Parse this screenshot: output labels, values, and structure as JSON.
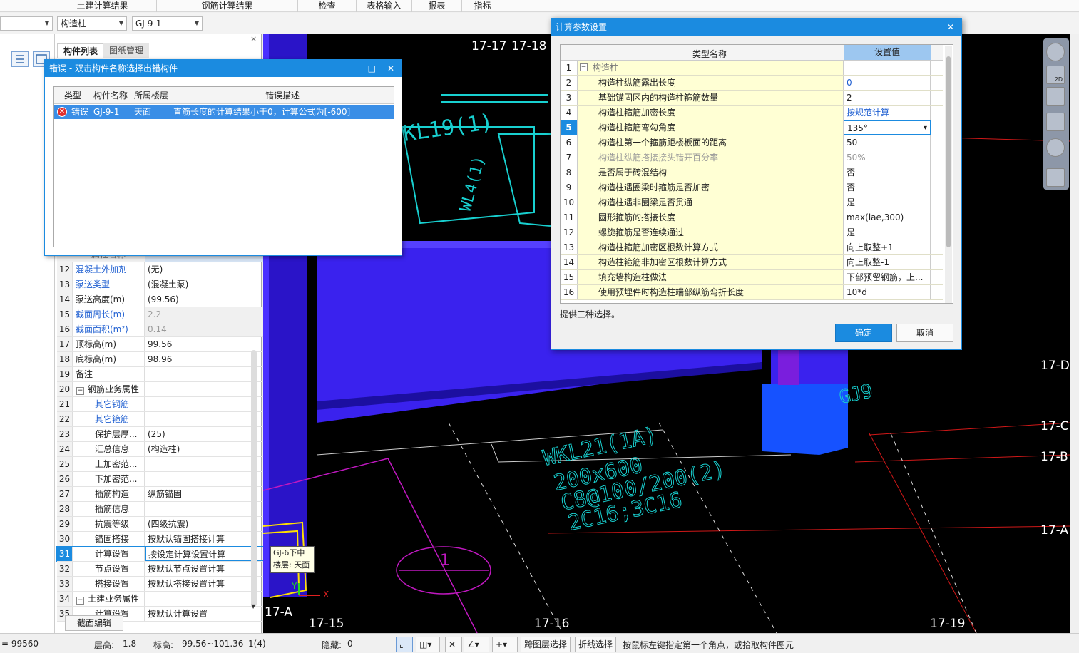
{
  "top_tabs": [
    "土建计算结果",
    "钢筋计算结果",
    "检查",
    "表格输入",
    "报表",
    "指标"
  ],
  "filter": {
    "combo1": "",
    "combo2": "构造柱",
    "combo3": "GJ-9-1"
  },
  "panel": {
    "tabs": [
      "构件列表",
      "图纸管理"
    ],
    "header_partial": "属性名称",
    "rows": [
      {
        "n": "12",
        "k": "混凝土外加剂",
        "v": "(无)",
        "kblue": true
      },
      {
        "n": "13",
        "k": "泵送类型",
        "v": "(混凝土泵)",
        "kblue": true
      },
      {
        "n": "14",
        "k": "泵送高度(m)",
        "v": "(99.56)"
      },
      {
        "n": "15",
        "k": "截面周长(m)",
        "v": "2.2",
        "kblue": true,
        "vgray": true
      },
      {
        "n": "16",
        "k": "截面面积(m²)",
        "v": "0.14",
        "kblue": true,
        "vgray": true
      },
      {
        "n": "17",
        "k": "顶标高(m)",
        "v": "99.56"
      },
      {
        "n": "18",
        "k": "底标高(m)",
        "v": "98.96"
      },
      {
        "n": "19",
        "k": "备注",
        "v": ""
      },
      {
        "n": "20",
        "k": "钢筋业务属性",
        "v": "",
        "group": true
      },
      {
        "n": "21",
        "k": "其它钢筋",
        "v": "",
        "kblue": true,
        "indent": true
      },
      {
        "n": "22",
        "k": "其它箍筋",
        "v": "",
        "kblue": true,
        "indent": true
      },
      {
        "n": "23",
        "k": "保护层厚...",
        "v": "(25)",
        "indent": true
      },
      {
        "n": "24",
        "k": "汇总信息",
        "v": "(构造柱)",
        "indent": true
      },
      {
        "n": "25",
        "k": "上加密范...",
        "v": "",
        "indent": true
      },
      {
        "n": "26",
        "k": "下加密范...",
        "v": "",
        "indent": true
      },
      {
        "n": "27",
        "k": "插筋构造",
        "v": "纵筋锚固",
        "indent": true
      },
      {
        "n": "28",
        "k": "插筋信息",
        "v": "",
        "indent": true
      },
      {
        "n": "29",
        "k": "抗震等级",
        "v": "(四级抗震)",
        "indent": true
      },
      {
        "n": "30",
        "k": "锚固搭接",
        "v": "按默认锚固搭接计算",
        "indent": true
      },
      {
        "n": "31",
        "k": "计算设置",
        "v": "按设定计算设置计算",
        "indent": true,
        "selected": true
      },
      {
        "n": "32",
        "k": "节点设置",
        "v": "按默认节点设置计算",
        "indent": true
      },
      {
        "n": "33",
        "k": "搭接设置",
        "v": "按默认搭接设置计算",
        "indent": true
      },
      {
        "n": "34",
        "k": "土建业务属性",
        "v": "",
        "group": true
      },
      {
        "n": "35",
        "k": "计算设置",
        "v": "按默认计算设置",
        "indent": true
      }
    ],
    "footer_button": "截面编辑"
  },
  "error_dialog": {
    "title": "错误 - 双击构件名称选择出错构件",
    "headers": [
      "类型",
      "构件名称",
      "所属楼层",
      "错误描述"
    ],
    "row": {
      "type": "错误",
      "name": "GJ-9-1",
      "floor": "天面",
      "desc": "直筋长度的计算结果小于0，计算公式为[-600]"
    }
  },
  "calc_dialog": {
    "title": "计算参数设置",
    "headers": [
      "类型名称",
      "设置值"
    ],
    "group_row": {
      "n": "1",
      "k": "构造柱"
    },
    "rows": [
      {
        "n": "2",
        "k": "构造柱纵筋露出长度",
        "v": "0",
        "vblue": true
      },
      {
        "n": "3",
        "k": "基础锚固区内的构造柱箍筋数量",
        "v": "2"
      },
      {
        "n": "4",
        "k": "构造柱箍筋加密长度",
        "v": "按规范计算",
        "vblue": true
      },
      {
        "n": "5",
        "k": "构造柱箍筋弯勾角度",
        "v": "135°",
        "selected": true
      },
      {
        "n": "6",
        "k": "构造柱第一个箍筋距楼板面的距离",
        "v": "50"
      },
      {
        "n": "7",
        "k": "构造柱纵筋搭接接头错开百分率",
        "v": "50%",
        "gray": true
      },
      {
        "n": "8",
        "k": "是否属于砖混结构",
        "v": "否"
      },
      {
        "n": "9",
        "k": "构造柱遇圈梁时箍筋是否加密",
        "v": "否"
      },
      {
        "n": "10",
        "k": "构造柱遇非圈梁是否贯通",
        "v": "是"
      },
      {
        "n": "11",
        "k": "圆形箍筋的搭接长度",
        "v": "max(lae,300)"
      },
      {
        "n": "12",
        "k": "螺旋箍筋是否连续通过",
        "v": "是"
      },
      {
        "n": "13",
        "k": "构造柱箍筋加密区根数计算方式",
        "v": "向上取整+1"
      },
      {
        "n": "14",
        "k": "构造柱箍筋非加密区根数计算方式",
        "v": "向上取整-1"
      },
      {
        "n": "15",
        "k": "填充墙构造柱做法",
        "v": "下部预留钢筋，上..."
      },
      {
        "n": "16",
        "k": "使用预埋件时构造柱端部纵筋弯折长度",
        "v": "10*d"
      }
    ],
    "hint": "提供三种选择。",
    "ok": "确定",
    "cancel": "取消"
  },
  "viewport": {
    "axis_labels": [
      "17-17",
      "17-18",
      "17-D",
      "17-C",
      "17-B",
      "17-A",
      "17-A",
      "17-15",
      "17-16",
      "17-19"
    ],
    "beam_label_top": "KL19(1)",
    "beam_label_left": "WL4(1)",
    "beam_text": [
      "WKL21(1A)",
      "200x600",
      "C8@100/200(2)",
      "2C16;3C16"
    ],
    "column_tag": "GJ9",
    "circle_label": "1",
    "tooltip": [
      "GJ-6下中",
      "楼层: 天面"
    ],
    "axis_x": "X",
    "axis_y": "Y"
  },
  "status": {
    "coord": "= 99560",
    "floor_height_label": "层高:",
    "floor_height": "1.8",
    "elev_label": "标高:",
    "elev": "99.56~101.36",
    "count": "1(4)",
    "hidden_label": "隐藏:",
    "hidden": "0",
    "cross_floor": "跨图层选择",
    "polyline": "折线选择",
    "prompt": "按鼠标左键指定第一个角点，或拾取构件图元"
  }
}
